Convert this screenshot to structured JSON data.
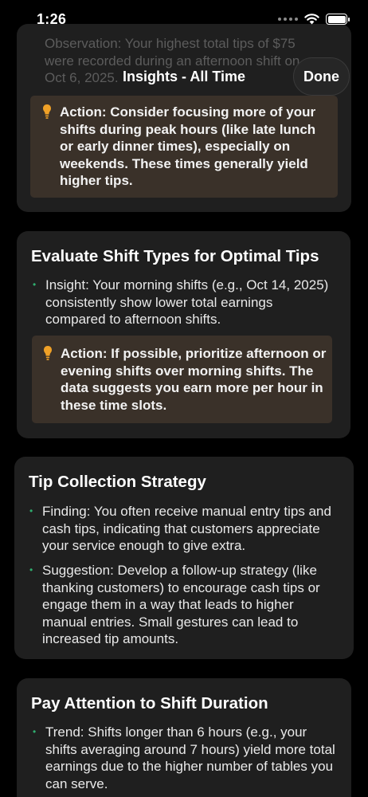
{
  "status_bar": {
    "time": "1:26"
  },
  "nav": {
    "title": "Insights - All Time",
    "done_label": "Done"
  },
  "cards": [
    {
      "faded_lines": [
        "Observation: Your highest total tips of $75",
        "were recorded during an afternoon shift on",
        "Oct 6, 2025."
      ],
      "action": "Action: Consider focusing more of your shifts during peak hours (like late lunch or early dinner times), especially on weekends. These times generally yield higher tips."
    },
    {
      "title": "Evaluate Shift Types for Optimal Tips",
      "bullets": [
        "Insight: Your morning shifts (e.g., Oct 14, 2025) consistently show lower total earnings compared to afternoon shifts."
      ],
      "action": "Action: If possible, prioritize afternoon or evening shifts over morning shifts. The data suggests you earn more per hour in these time slots."
    },
    {
      "title": "Tip Collection Strategy",
      "bullets": [
        "Finding: You often receive manual entry tips and cash tips, indicating that customers appreciate your service enough to give extra.",
        "Suggestion: Develop a follow-up strategy (like thanking customers) to encourage cash tips or engage them in a way that leads to higher manual entries. Small gestures can lead to increased tip amounts."
      ]
    },
    {
      "title": "Pay Attention to Shift Duration",
      "bullets": [
        "Trend: Shifts longer than 6 hours (e.g., your shifts averaging around 7 hours) yield more total earnings due to the higher number of tables you can serve."
      ]
    }
  ]
}
